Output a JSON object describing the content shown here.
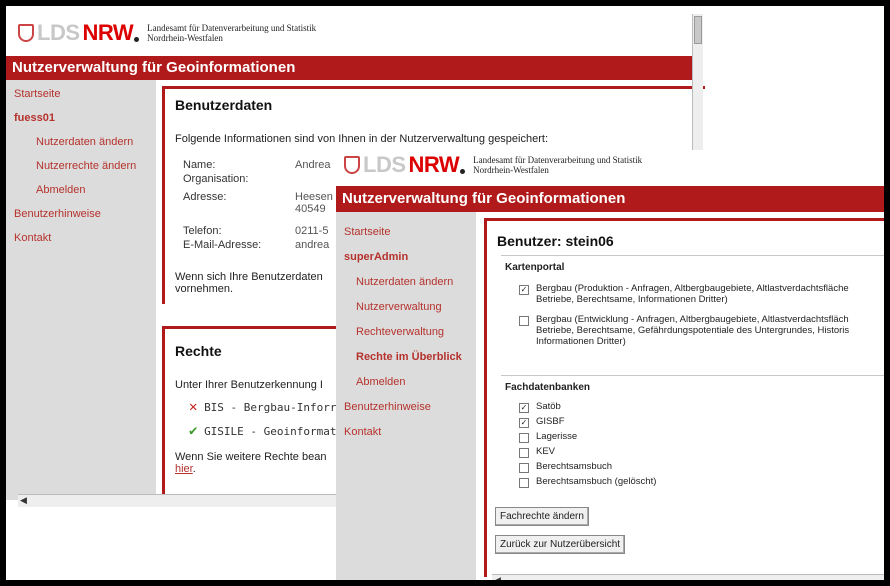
{
  "back_window": {
    "logo": {
      "lds": "LDS",
      "nrw": "NRW",
      "subtitle_line1": "Landesamt für Datenverarbeitung und Statistik",
      "subtitle_line2": "Nordrhein-Westfalen"
    },
    "title": "Nutzerverwaltung für Geoinformationen",
    "nav": {
      "startseite": "Startseite",
      "user": "fuess01",
      "nutzerdaten": "Nutzerdaten ändern",
      "nutzerrechte": "Nutzerrechte ändern",
      "abmelden": "Abmelden",
      "benutzerhinweise": "Benutzerhinweise",
      "kontakt": "Kontakt"
    },
    "benutzerdaten": {
      "title": "Benutzerdaten",
      "intro": "Folgende Informationen sind von Ihnen in der Nutzerverwaltung gespeichert:",
      "name_label": "Name:",
      "name_value": "Andrea",
      "org_label": "Organisation:",
      "adresse_label": "Adresse:",
      "adresse_value1": "Heesen",
      "adresse_value2": "40549",
      "telefon_label": "Telefon:",
      "telefon_value": "0211-5",
      "email_label": "E-Mail-Adresse:",
      "email_value": "andrea",
      "note_line1": "Wenn sich Ihre Benutzerdaten",
      "note_line2": "vornehmen."
    },
    "rechte": {
      "title": "Rechte",
      "intro": "Unter Ihrer Benutzerkennung I",
      "item1": "BIS - Bergbau-Inforr",
      "item2": "GISILE - Geoinformat",
      "note_line1": "Wenn Sie weitere Rechte bean",
      "link": "hier"
    }
  },
  "front_window": {
    "logo": {
      "lds": "LDS",
      "nrw": "NRW",
      "subtitle_line1": "Landesamt für Datenverarbeitung und Statistik",
      "subtitle_line2": "Nordrhein-Westfalen"
    },
    "title": "Nutzerverwaltung für Geoinformationen",
    "nav": {
      "startseite": "Startseite",
      "user": "superAdmin",
      "nutzerdaten": "Nutzerdaten ändern",
      "nutzerverwaltung": "Nutzerverwaltung",
      "rechteverwaltung": "Rechteverwaltung",
      "rechte_ueberblick": "Rechte im Überblick",
      "abmelden": "Abmelden",
      "benutzerhinweise": "Benutzerhinweise",
      "kontakt": "Kontakt"
    },
    "benutzer_title": "Benutzer: stein06",
    "kartenportal": {
      "title": "Kartenportal",
      "item1_line1": "Bergbau (Produktion - Anfragen, Altbergbaugebiete, Altlastverdachtsfläche",
      "item1_line2": "Betriebe, Berechtsame, Informationen Dritter)",
      "item2_line1": "Bergbau (Entwicklung - Anfragen, Altbergbaugebiete, Altlastverdachtsfläch",
      "item2_line2": "Betriebe, Berechtsame, Gefährdungspotentiale des Untergrundes, Historis",
      "item2_line3": "Informationen Dritter)"
    },
    "fachdatenbanken": {
      "title": "Fachdatenbanken",
      "items": [
        "Satöb",
        "GISBF",
        "Lagerisse",
        "KEV",
        "Berechtsamsbuch",
        "Berechtsamsbuch (gelöscht)"
      ],
      "checked": [
        true,
        true,
        false,
        false,
        false,
        false
      ]
    },
    "buttons": {
      "fachrechte": "Fachrechte ändern",
      "zurueck": "Zurück zur Nutzerübersicht"
    }
  },
  "colors": {
    "brand_red": "#b11a1a",
    "link_red": "#b5322d",
    "sidebar_gray": "#dcdcdc"
  }
}
